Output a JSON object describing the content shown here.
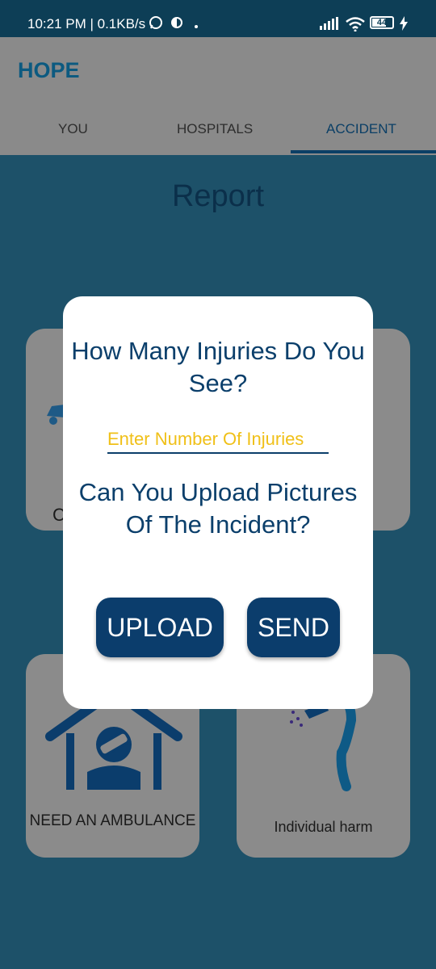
{
  "status_bar": {
    "time": "10:21 PM | 0.1KB/s",
    "battery": "44"
  },
  "app": {
    "title": "HOPE"
  },
  "tabs": [
    {
      "label": "YOU"
    },
    {
      "label": "HOSPITALS"
    },
    {
      "label": "ACCIDENT"
    }
  ],
  "main": {
    "title": "Report",
    "cards": [
      {
        "label": "C"
      },
      {
        "label": ""
      },
      {
        "label": "NEED AN AMBULANCE"
      },
      {
        "label": "Individual harm"
      }
    ]
  },
  "dialog": {
    "question_1": "How Many Injuries Do You See?",
    "injuries_placeholder": "Enter Number Of Injuries",
    "question_2": "Can You Upload Pictures Of The Incident?",
    "upload_label": "UPLOAD",
    "send_label": "SEND"
  },
  "colors": {
    "primary": "#0b3d6c",
    "placeholder": "#f0c018",
    "background": "#1d5169"
  }
}
